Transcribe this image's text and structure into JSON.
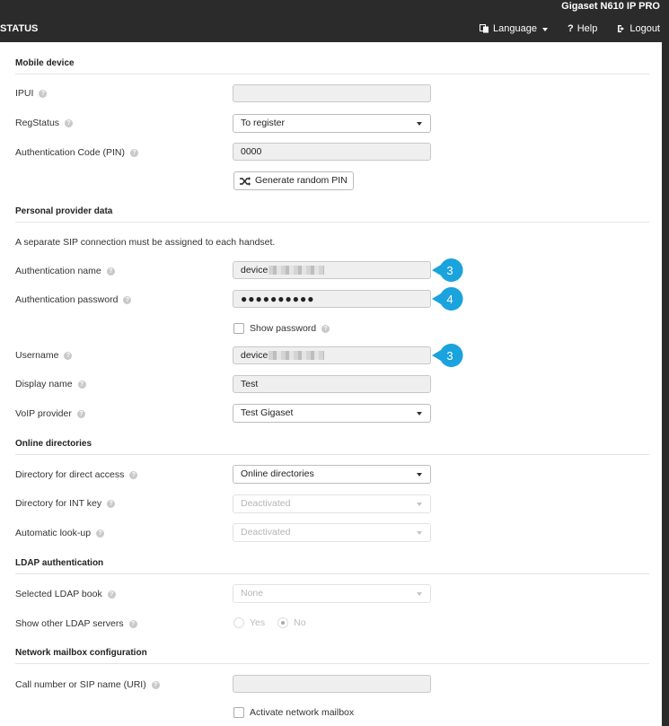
{
  "header": {
    "brand": "Gigaset N610 IP PRO",
    "status": "STATUS",
    "language": "Language",
    "help": "Help",
    "logout": "Logout"
  },
  "sections": {
    "mobile_device": "Mobile device",
    "personal_provider": "Personal provider data",
    "online_directories": "Online directories",
    "ldap_auth": "LDAP authentication",
    "network_mailbox": "Network mailbox configuration"
  },
  "mobile": {
    "ipui_label": "IPUI",
    "ipui_value": "",
    "regstatus_label": "RegStatus",
    "regstatus_value": "To register",
    "pin_label": "Authentication Code (PIN)",
    "pin_value": "0000",
    "generate_pin": "Generate random PIN"
  },
  "provider": {
    "note": "A separate SIP connection must be assigned to each handset.",
    "auth_name_label": "Authentication name",
    "auth_name_value": "device",
    "auth_pass_label": "Authentication password",
    "auth_pass_value": "●●●●●●●●●●",
    "show_password": "Show password",
    "username_label": "Username",
    "username_value": "device",
    "display_name_label": "Display name",
    "display_name_value": "Test",
    "voip_label": "VoIP provider",
    "voip_value": "Test Gigaset"
  },
  "directories": {
    "direct_label": "Directory for direct access",
    "direct_value": "Online directories",
    "int_label": "Directory for INT key",
    "int_value": "Deactivated",
    "lookup_label": "Automatic look-up",
    "lookup_value": "Deactivated"
  },
  "ldap": {
    "book_label": "Selected LDAP book",
    "book_value": "None",
    "other_label": "Show other LDAP servers",
    "yes": "Yes",
    "no": "No",
    "selected": "No"
  },
  "mailbox": {
    "uri_label": "Call number or SIP name (URI)",
    "uri_value": "",
    "activate": "Activate network mailbox"
  },
  "markers": {
    "auth_name": "3",
    "auth_password": "4",
    "username": "3",
    "color": "#1aa3dc"
  }
}
